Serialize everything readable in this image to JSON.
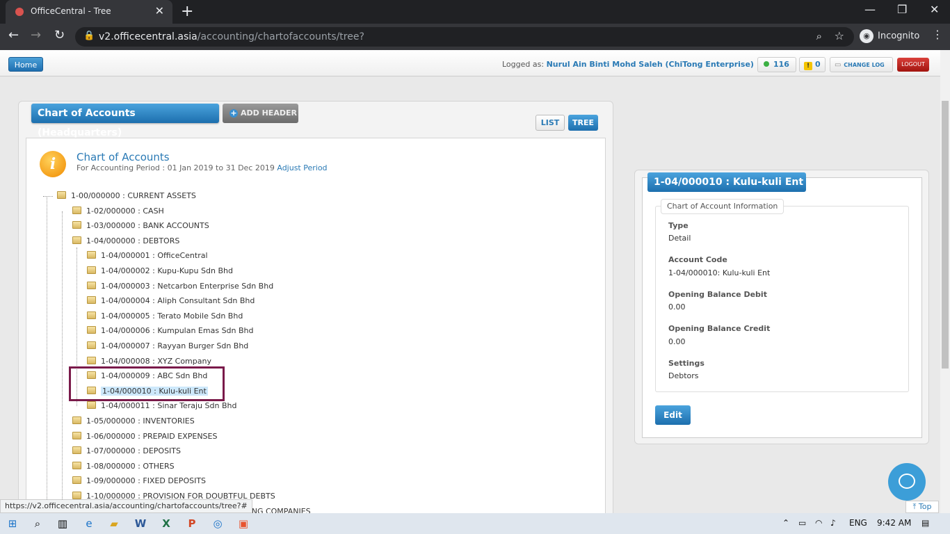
{
  "browser": {
    "tab_title": "OfficeCentral - Tree",
    "url_host": "v2.officecentral.asia",
    "url_path": "/accounting/chartofaccounts/tree?",
    "profile": "Incognito",
    "status_url": "https://v2.officecentral.asia/accounting/chartofaccounts/tree?#"
  },
  "topbar": {
    "home": "Home",
    "logged_prefix": "Logged as:",
    "user": "Nurul Ain Binti Mohd Saleh (ChiTong Enterprise)",
    "count_online": "116",
    "count_warn": "0",
    "change_log": "CHANGE LOG",
    "logout": "LOGOUT"
  },
  "main": {
    "title": "Chart of Accounts (Headquarters)",
    "add_header": "ADD HEADER",
    "list": "LIST",
    "tree": "TREE",
    "coa_title": "Chart of Accounts",
    "period_text": "For Accounting Period : 01 Jan 2019 to 31 Dec 2019",
    "adjust": "Adjust Period"
  },
  "tree": [
    "1-00/000000 : CURRENT ASSETS",
    "1-02/000000 : CASH",
    "1-03/000000 : BANK ACCOUNTS",
    "1-04/000000 : DEBTORS",
    "1-04/000001 : OfficeCentral",
    "1-04/000002 : Kupu-Kupu Sdn Bhd",
    "1-04/000003 : Netcarbon Enterprise Sdn Bhd",
    "1-04/000004 : Aliph Consultant Sdn Bhd",
    "1-04/000005 : Terato Mobile Sdn Bhd",
    "1-04/000006 : Kumpulan Emas Sdn Bhd",
    "1-04/000007 : Rayyan Burger Sdn Bhd",
    "1-04/000008 : XYZ Company",
    "1-04/000009 : ABC Sdn Bhd",
    "1-04/000010 : Kulu-kuli Ent",
    "1-04/000011 : Sinar Teraju Sdn Bhd",
    "1-05/000000 : INVENTORIES",
    "1-06/000000 : PREPAID EXPENSES",
    "1-07/000000 : DEPOSITS",
    "1-08/000000 : OTHERS",
    "1-09/000000 : FIXED DEPOSITS",
    "1-10/000000 : PROVISION FOR DOUBTFUL DEBTS",
    "DING COMPANIES"
  ],
  "detail": {
    "title": "1-04/000010 : Kulu-kuli Ent",
    "legend": "Chart of Account Information",
    "type_label": "Type",
    "type_value": "Detail",
    "code_label": "Account Code",
    "code_value": "1-04/000010: Kulu-kuli Ent",
    "debit_label": "Opening Balance Debit",
    "debit_value": "0.00",
    "credit_label": "Opening Balance Credit",
    "credit_value": "0.00",
    "settings_label": "Settings",
    "settings_value": "Debtors",
    "edit": "Edit"
  },
  "misc": {
    "top": "Top"
  },
  "taskbar": {
    "lang": "ENG",
    "time": "9:42 AM"
  }
}
